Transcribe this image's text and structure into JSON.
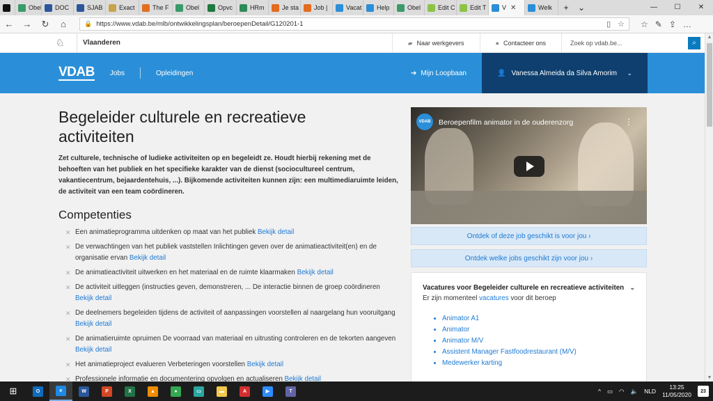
{
  "browser": {
    "tabs": [
      {
        "label": "",
        "color": "#111111",
        "active": false
      },
      {
        "label": "Obel",
        "color": "#3a9a6a",
        "active": false
      },
      {
        "label": "DOC",
        "color": "#2b579a",
        "active": false
      },
      {
        "label": "SJAB",
        "color": "#2b579a",
        "active": false
      },
      {
        "label": "Exact",
        "color": "#c9a24a",
        "active": false
      },
      {
        "label": "The F",
        "color": "#e07020",
        "active": false
      },
      {
        "label": "Obel",
        "color": "#3a9a6a",
        "active": false
      },
      {
        "label": "Opvc",
        "color": "#1e7a3c",
        "active": false
      },
      {
        "label": "HRm",
        "color": "#2e8b57",
        "active": false
      },
      {
        "label": "Je sta",
        "color": "#e56b1f",
        "active": false
      },
      {
        "label": "Job |",
        "color": "#e56b1f",
        "active": false
      },
      {
        "label": "Vacat",
        "color": "#2a8fd8",
        "active": false
      },
      {
        "label": "Help",
        "color": "#2a8fd8",
        "active": false
      },
      {
        "label": "Obel",
        "color": "#3a9a6a",
        "active": false
      },
      {
        "label": "Edit C",
        "color": "#8bc34a",
        "active": false
      },
      {
        "label": "Edit T",
        "color": "#8bc34a",
        "active": false
      },
      {
        "label": "V",
        "color": "#2a8fd8",
        "active": true
      },
      {
        "label": "Welk",
        "color": "#2a8fd8",
        "active": false
      }
    ],
    "new_tab": "+",
    "tab_dropdown": "⌄",
    "url": "https://www.vdab.be/mlb/ontwikkelingsplan/beroepenDetail/G120201-1"
  },
  "flemish_bar": {
    "brand": "Vlaanderen",
    "employers": "Naar werkgevers",
    "contact": "Contacteer ons",
    "search_placeholder": "Zoek op vdab.be..."
  },
  "vdab_bar": {
    "logo": "VDAB",
    "jobs": "Jobs",
    "opleidingen": "Opleidingen",
    "loopbaan": "Mijn Loopbaan",
    "user": "Vanessa Almeida da Silva Amorim"
  },
  "content": {
    "title": "Begeleider culturele en recreatieve activiteiten",
    "intro": "Zet culturele, technische of ludieke activiteiten op en begeleidt ze. Houdt hierbij rekening met de behoeften van het publiek en het specifieke karakter van de dienst (sociocultureel centrum, vakantiecentrum, bejaardentehuis, ...). Bijkomende activiteiten kunnen zijn: een multimediaruimte leiden, de activiteit van een team coördineren.",
    "competenties_heading": "Competenties",
    "detail_label": "Bekijk detail",
    "competenties": [
      "Een animatieprogramma uitdenken op maat van het publiek",
      "De verwachtingen van het publiek vaststellen Inlichtingen geven over de animatieactiviteit(en) en de organisatie ervan",
      "De animatieactiviteit uitwerken en het materiaal en de ruimte klaarmaken",
      "De activiteit uitleggen (instructies geven, demonstreren, ... De interactie binnen de groep coördineren",
      "De deelnemers begeleiden tijdens de activiteit of aanpassingen voorstellen al naargelang hun vooruitgang",
      "De animatieruimte opruimen De voorraad van materiaal en uitrusting controleren en de tekorten aangeven",
      "Het animatieproject evalueren Verbeteringen voorstellen",
      "Professionele informatie en documentering opvolgen en actualiseren"
    ]
  },
  "sidebar": {
    "video_title": "Beroepenfilm animator in de ouderenzorg",
    "video_logo": "VDAB",
    "cta1": "Ontdek of deze job geschikt is voor jou ›",
    "cta2": "Ontdek welke jobs geschikt zijn voor jou ›",
    "vacatures_heading": "Vacatures voor Begeleider culturele en recreatieve activiteiten",
    "vacatures_sub_before": "Er zijn momenteel",
    "vacatures_sub_link": "vacatures",
    "vacatures_sub_after": "voor dit beroep",
    "vacatures": [
      "Animator A1",
      "Animator",
      "Animator M/V",
      "Assistent Manager Fastfoodrestaurant (M/V)",
      "Medewerker karting"
    ]
  },
  "taskbar": {
    "apps": [
      {
        "icon": "outlook-icon",
        "label": "O",
        "color": "#0f6cbd"
      },
      {
        "icon": "edge-icon",
        "label": "e",
        "color": "#1e88e5"
      },
      {
        "icon": "word-icon",
        "label": "W",
        "color": "#2b579a"
      },
      {
        "icon": "powerpoint-icon",
        "label": "P",
        "color": "#d24726"
      },
      {
        "icon": "excel-icon",
        "label": "X",
        "color": "#217346"
      },
      {
        "icon": "vlc-icon",
        "label": "▲",
        "color": "#f08c00"
      },
      {
        "icon": "chrome-icon",
        "label": "●",
        "color": "#34a853"
      },
      {
        "icon": "sticky-notes-icon",
        "label": "▭",
        "color": "#2aa7a0"
      },
      {
        "icon": "file-explorer-icon",
        "label": "▬",
        "color": "#f2c94c"
      },
      {
        "icon": "acrobat-icon",
        "label": "A",
        "color": "#d32f2f"
      },
      {
        "icon": "zoom-icon",
        "label": "▶",
        "color": "#2d8cff"
      },
      {
        "icon": "teams-icon",
        "label": "T",
        "color": "#6264a7"
      }
    ],
    "language": "NLD",
    "time": "13:25",
    "date": "11/05/2020",
    "notifications": "23"
  }
}
